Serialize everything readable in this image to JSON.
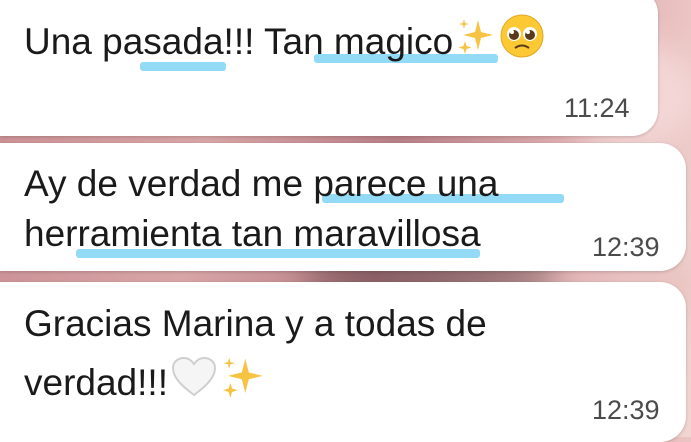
{
  "messages": [
    {
      "text": "Una pasada!!! Tan magico",
      "time": "11:24"
    },
    {
      "line1": "Ay de verdad me parece una",
      "line2": "herramienta tan maravillosa",
      "time": "12:39"
    },
    {
      "line1": "Gracias Marina y a todas de",
      "line2": "verdad!!!",
      "time": "12:39"
    }
  ],
  "icons": [
    "sparkles-icon",
    "pleading-face-icon",
    "white-heart-icon"
  ]
}
